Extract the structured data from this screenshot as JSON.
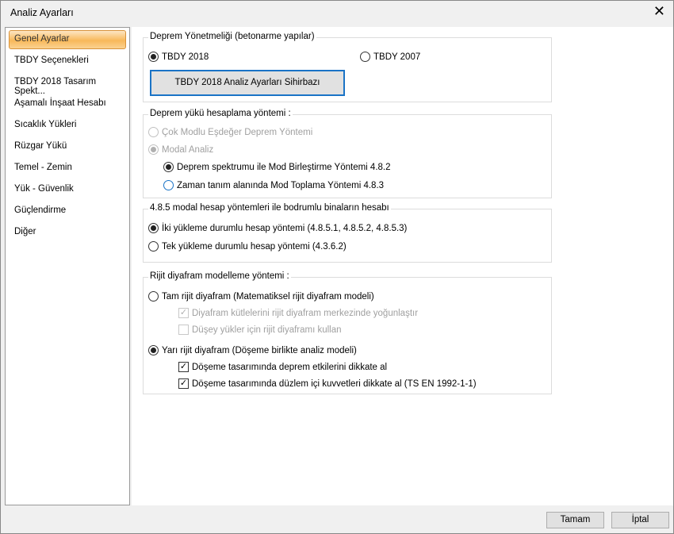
{
  "window": {
    "title": "Analiz Ayarları"
  },
  "sidebar": {
    "items": [
      "Genel Ayarlar",
      "TBDY Seçenekleri",
      "TBDY 2018 Tasarım Spekt...",
      "Aşamalı İnşaat Hesabı",
      "Sıcaklık Yükleri",
      "Rüzgar Yükü",
      "Temel - Zemin",
      "Yük - Güvenlik",
      "Güçlendirme",
      "Diğer"
    ],
    "selected": "Genel Ayarlar"
  },
  "g1": {
    "legend": "Deprem Yönetmeliği (betonarme yapılar)",
    "opt1": "TBDY 2018",
    "opt2": "TBDY 2007",
    "wizard": "TBDY 2018 Analiz Ayarları Sihirbazı"
  },
  "g2": {
    "legend": "Deprem yükü hesaplama yöntemi :",
    "opt1": "Çok Modlu Eşdeğer Deprem Yöntemi",
    "opt2": "Modal Analiz",
    "opt3": "Deprem spektrumu ile Mod Birleştirme Yöntemi 4.8.2",
    "opt4": "Zaman tanım alanında Mod Toplama Yöntemi 4.8.3"
  },
  "g3": {
    "legend": "4.8.5 modal hesap yöntemleri ile bodrumlu binaların hesabı",
    "opt1": "İki yükleme durumlu hesap yöntemi (4.8.5.1, 4.8.5.2, 4.8.5.3)",
    "opt2": "Tek yükleme durumlu hesap yöntemi (4.3.6.2)"
  },
  "g4": {
    "legend": "Rijit diyafram modelleme yöntemi  :",
    "opt1": "Tam rijit diyafram (Matematiksel rijit diyafram modeli)",
    "cb1": "Diyafram kütlelerini rijit diyafram merkezinde yoğunlaştır",
    "cb2": "Düşey yükler için rijit diyaframı kullan",
    "opt2": "Yarı rijit diyafram (Döşeme birlikte analiz modeli)",
    "cb3": "Döşeme tasarımında deprem etkilerini dikkate al",
    "cb4": "Döşeme tasarımında düzlem içi kuvvetleri dikkate al (TS EN 1992-1-1)"
  },
  "footer": {
    "ok": "Tamam",
    "cancel": "İptal"
  }
}
